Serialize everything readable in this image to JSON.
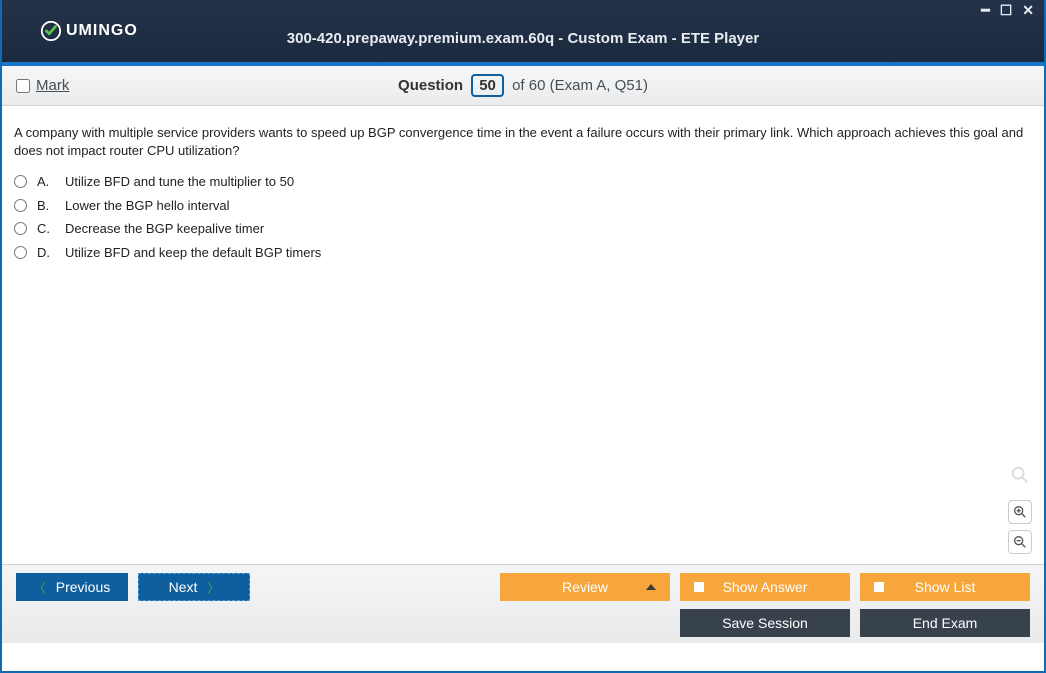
{
  "window": {
    "logo_text": "UMINGO",
    "title": "300-420.prepaway.premium.exam.60q - Custom Exam - ETE Player"
  },
  "question_bar": {
    "mark_label": "Mark",
    "question_label": "Question",
    "current_number": "50",
    "of_text": " of 60 (Exam A, Q51)"
  },
  "question": {
    "text": "A company with multiple service providers wants to speed up BGP convergence time in the event a failure occurs with their primary link. Which approach achieves this goal and does not impact router CPU utilization?",
    "answers": [
      {
        "letter": "A.",
        "text": "Utilize BFD and tune the multiplier to 50"
      },
      {
        "letter": "B.",
        "text": "Lower the BGP hello interval"
      },
      {
        "letter": "C.",
        "text": "Decrease the BGP keepalive timer"
      },
      {
        "letter": "D.",
        "text": "Utilize BFD and keep the default BGP timers"
      }
    ]
  },
  "buttons": {
    "previous": "Previous",
    "next": "Next",
    "review": "Review",
    "show_answer": "Show Answer",
    "show_list": "Show List",
    "save_session": "Save Session",
    "end_exam": "End Exam"
  }
}
